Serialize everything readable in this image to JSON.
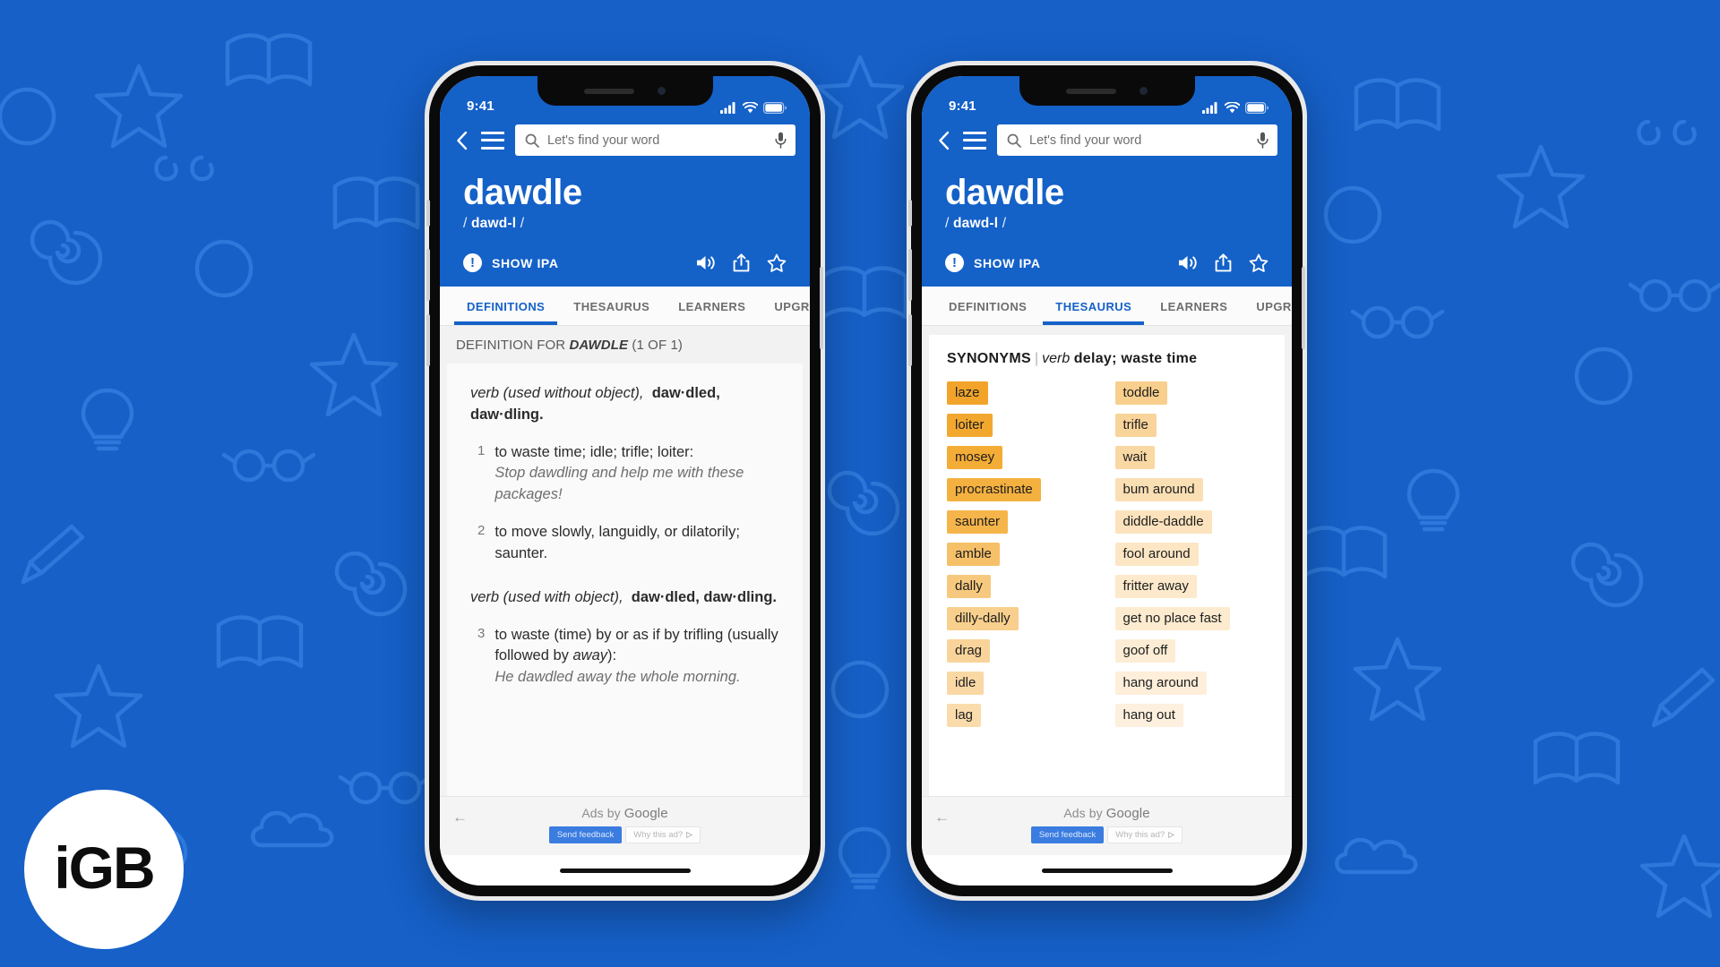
{
  "background": {
    "color": "#1660c8",
    "doodle_color": "#2a74d6",
    "motifs": [
      "star",
      "open-book",
      "light-bulb",
      "spiral",
      "circle",
      "glasses",
      "pencil",
      "cloud"
    ]
  },
  "watermark": {
    "name": "igb-logo",
    "text": "iGB",
    "circle_color": "#ffffff",
    "text_color": "#0d0d0d"
  },
  "phones": [
    {
      "id": "left",
      "status": {
        "time": "9:41",
        "signal": "signal-icon",
        "wifi": "wifi-icon",
        "battery": "battery-icon"
      },
      "header": {
        "accent": "#1461c8",
        "back_icon": "chevron-left-icon",
        "menu_icon": "hamburger-menu-icon",
        "search": {
          "placeholder": "Let's find your word",
          "value": "",
          "search_icon": "search-icon",
          "mic_icon": "microphone-icon"
        },
        "word": "dawdle",
        "phonetic_pre": "/ ",
        "phonetic_bold": "dawd-l",
        "phonetic_post": " /",
        "ipa_badge": "!",
        "ipa_label": "SHOW IPA",
        "actions": [
          "speaker-icon",
          "share-icon",
          "star-icon"
        ]
      },
      "tabs": [
        {
          "label": "DEFINITIONS",
          "active": true
        },
        {
          "label": "THESAURUS",
          "active": false
        },
        {
          "label": "LEARNERS",
          "active": false
        },
        {
          "label": "UPGRADE",
          "active": false
        }
      ],
      "definitions": {
        "heading_pre": "DEFINITION FOR ",
        "heading_word": "DAWDLE",
        "heading_post": " (1 OF 1)",
        "blocks": [
          {
            "pos_italic": "verb (used without object),",
            "pos_bold": "daw·dled, daw·dling.",
            "senses": [
              {
                "num": "1",
                "text": "to waste time; idle; trifle; loiter:",
                "example": "Stop dawdling and help me with these packages!"
              },
              {
                "num": "2",
                "text": "to move slowly, languidly, or dilatorily; saunter.",
                "example": ""
              }
            ]
          },
          {
            "pos_italic": "verb (used with object),",
            "pos_bold": "daw·dled, daw·dling.",
            "senses": [
              {
                "num": "3",
                "text": "to waste (time) by or as if by trifling (usually followed by away):",
                "example": "He dawdled away the whole morning."
              }
            ]
          }
        ]
      },
      "ad": {
        "back_icon": "arrow-left-icon",
        "label_pre": "Ads by ",
        "label_brand": "Google",
        "feedback_label": "Send feedback",
        "why_label": "Why this ad?",
        "why_icon": "play-triangle-icon"
      }
    },
    {
      "id": "right",
      "status": {
        "time": "9:41",
        "signal": "signal-icon",
        "wifi": "wifi-icon",
        "battery": "battery-icon"
      },
      "header": {
        "accent": "#1461c8",
        "back_icon": "chevron-left-icon",
        "menu_icon": "hamburger-menu-icon",
        "search": {
          "placeholder": "Let's find your word",
          "value": "",
          "search_icon": "search-icon",
          "mic_icon": "microphone-icon"
        },
        "word": "dawdle",
        "phonetic_pre": "/ ",
        "phonetic_bold": "dawd-l",
        "phonetic_post": " /",
        "ipa_badge": "!",
        "ipa_label": "SHOW IPA",
        "actions": [
          "speaker-icon",
          "share-icon",
          "star-icon"
        ]
      },
      "tabs": [
        {
          "label": "DEFINITIONS",
          "active": false
        },
        {
          "label": "THESAURUS",
          "active": true
        },
        {
          "label": "LEARNERS",
          "active": false
        },
        {
          "label": "UPGRADE",
          "active": false
        }
      ],
      "thesaurus": {
        "heading_label": "SYNONYMS",
        "heading_sep": "|",
        "heading_pos": "verb",
        "heading_sense": "delay; waste time",
        "columns": [
          {
            "name": "left-column",
            "items": [
              {
                "word": "laze",
                "color": "#f2a42a"
              },
              {
                "word": "loiter",
                "color": "#f2a82f"
              },
              {
                "word": "mosey",
                "color": "#f3ac36"
              },
              {
                "word": "procrastinate",
                "color": "#f4b13f"
              },
              {
                "word": "saunter",
                "color": "#f5b54a"
              },
              {
                "word": "amble",
                "color": "#f6c069"
              },
              {
                "word": "dally",
                "color": "#f7c97f"
              },
              {
                "word": "dilly-dally",
                "color": "#f8cf8c"
              },
              {
                "word": "drag",
                "color": "#f9d49a"
              },
              {
                "word": "idle",
                "color": "#f9d8a4"
              },
              {
                "word": "lag",
                "color": "#fadcac"
              }
            ]
          },
          {
            "name": "right-column",
            "items": [
              {
                "word": "toddle",
                "color": "#f8cf8c"
              },
              {
                "word": "trifle",
                "color": "#f9d49a"
              },
              {
                "word": "wait",
                "color": "#fad8a4"
              },
              {
                "word": "bum around",
                "color": "#fbdfb4"
              },
              {
                "word": "diddle-daddle",
                "color": "#fce3bd"
              },
              {
                "word": "fool around",
                "color": "#fce6c4"
              },
              {
                "word": "fritter away",
                "color": "#fde9cb"
              },
              {
                "word": "get no place fast",
                "color": "#fdebd0"
              },
              {
                "word": "goof off",
                "color": "#fdedd5"
              },
              {
                "word": "hang around",
                "color": "#feeeda"
              },
              {
                "word": "hang out",
                "color": "#fef0de"
              }
            ]
          }
        ]
      },
      "ad": {
        "back_icon": "arrow-left-icon",
        "label_pre": "Ads by ",
        "label_brand": "Google",
        "feedback_label": "Send feedback",
        "why_label": "Why this ad?",
        "why_icon": "play-triangle-icon"
      }
    }
  ]
}
